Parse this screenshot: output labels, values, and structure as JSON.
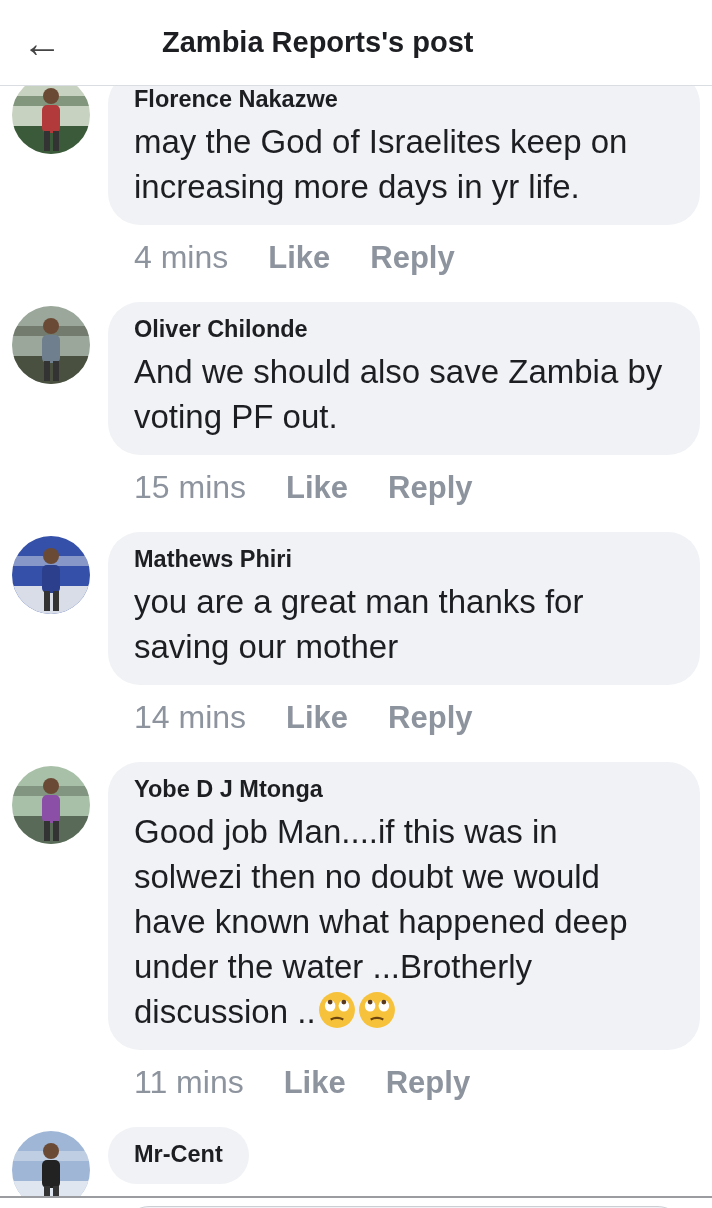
{
  "header": {
    "back_icon": "←",
    "title": "Zambia Reports's post"
  },
  "comments": [
    {
      "author": "Florence Nakazwe",
      "text": "may the God of Israelites keep on increasing more days in yr life.",
      "time": "4 mins",
      "actions": [
        "Like",
        "Reply"
      ]
    },
    {
      "author": "Oliver Chilonde",
      "text": "And we should also save Zambia by voting PF out.",
      "time": "15 mins",
      "actions": [
        "Like",
        "Reply"
      ]
    },
    {
      "author": "Mathews Phiri",
      "text": "you are a great man thanks for saving our mother",
      "time": "14 mins",
      "actions": [
        "Like",
        "Reply"
      ]
    },
    {
      "author": "Yobe D J Mtonga",
      "text": "Good job Man....if this was in solwezi then no doubt we would have known what happened deep under the water ...Brotherly discussion ..",
      "trailing_icons": [
        {
          "kind": "eye-roll"
        },
        {
          "kind": "eye-roll"
        }
      ],
      "time": "11 mins",
      "actions": [
        "Like",
        "Reply"
      ]
    },
    {
      "author": "Mr-Cent"
    }
  ],
  "composer": {
    "kind": "field"
  }
}
